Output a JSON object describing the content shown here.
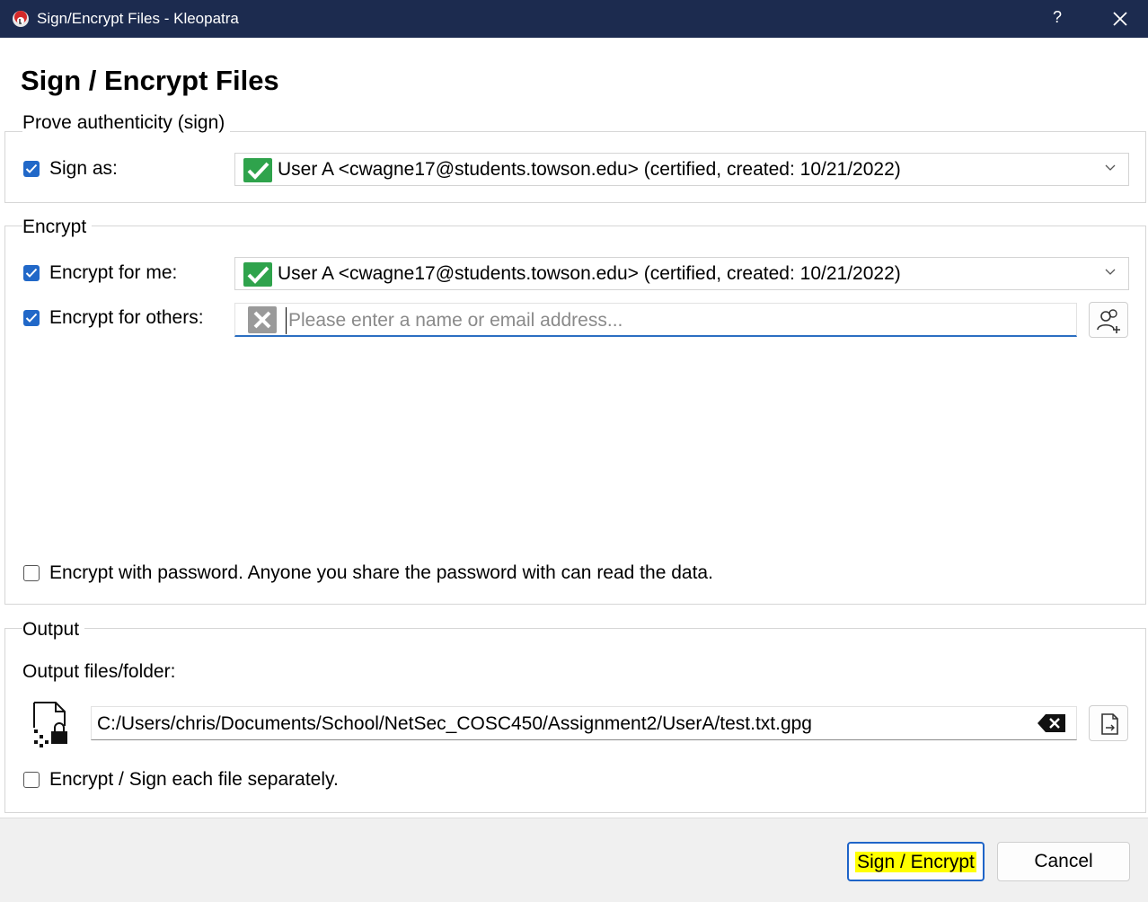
{
  "window": {
    "title": "Sign/Encrypt Files - Kleopatra",
    "help_glyph": "?"
  },
  "page_title": "Sign / Encrypt Files",
  "sign_group": {
    "title": "Prove authenticity (sign)",
    "sign_as": {
      "label": "Sign as:",
      "checked": true,
      "value": "User A <cwagne17@students.towson.edu> (certified, created: 10/21/2022)"
    }
  },
  "encrypt_group": {
    "title": "Encrypt",
    "encrypt_for_me": {
      "label": "Encrypt for me:",
      "checked": true,
      "value": "User A <cwagne17@students.towson.edu> (certified, created: 10/21/2022)"
    },
    "encrypt_for_others": {
      "label": "Encrypt for others:",
      "checked": true,
      "value": "",
      "placeholder": "Please enter a name or email address..."
    },
    "encrypt_with_password": {
      "label": "Encrypt with password. Anyone you share the password with can read the data.",
      "checked": false
    }
  },
  "output_group": {
    "title": "Output",
    "files_label": "Output files/folder:",
    "path": "C:/Users/chris/Documents/School/NetSec_COSC450/Assignment2/UserA/test.txt.gpg",
    "separately": {
      "label": "Encrypt / Sign each file separately.",
      "checked": false
    }
  },
  "buttons": {
    "primary": "Sign / Encrypt",
    "cancel": "Cancel"
  },
  "colors": {
    "titlebar": "#1c2b4f",
    "accent": "#2168c8",
    "ok_icon": "#2fa34c",
    "highlight": "#ffff00"
  },
  "icons": {
    "app": "kleopatra-app-icon",
    "certified": "certified-check-icon",
    "invalid": "invalid-x-icon",
    "add_recipient": "add-recipient-icon",
    "output_file": "encrypted-file-icon",
    "clear": "clear-backspace-icon",
    "browse": "browse-file-icon"
  }
}
